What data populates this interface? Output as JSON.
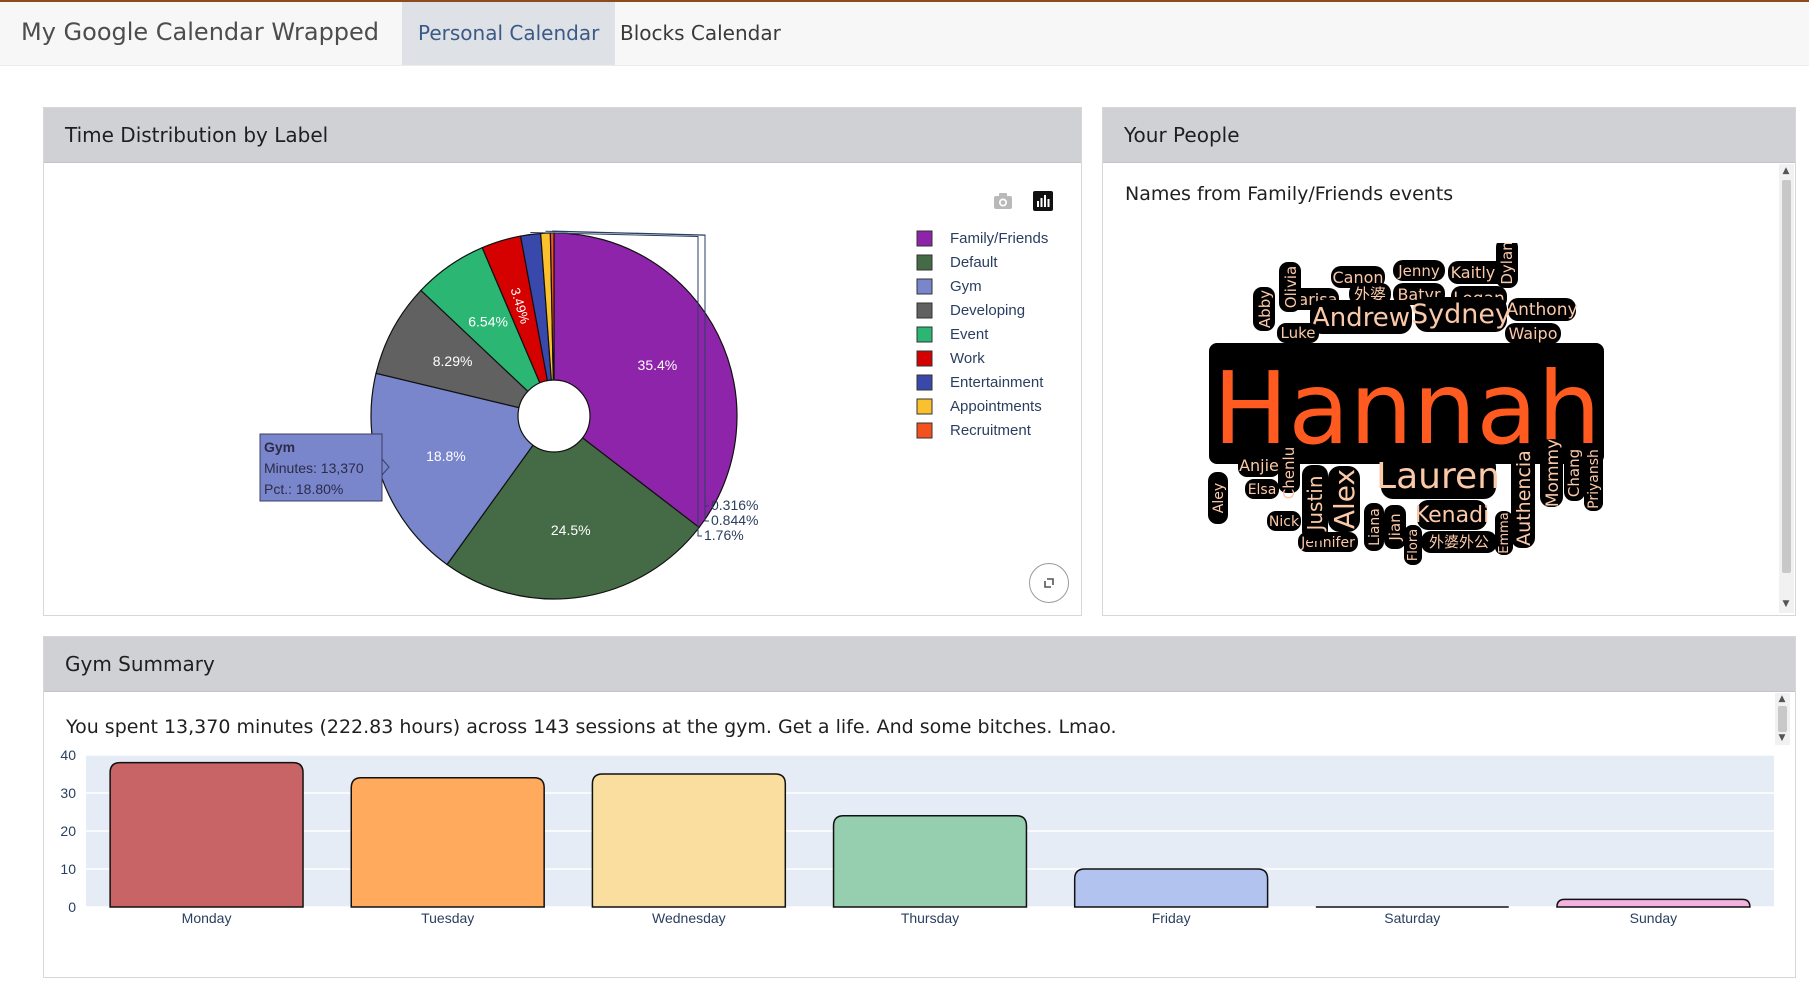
{
  "navbar": {
    "brand": "My Google Calendar Wrapped",
    "tabs": [
      {
        "label": "Personal Calendar",
        "active": true
      },
      {
        "label": "Blocks Calendar",
        "active": false
      }
    ]
  },
  "pie_card": {
    "title": "Time Distribution by Label",
    "tooltip": {
      "title": "Gym",
      "line1": "Minutes: 13,370",
      "line2": "Pct.: 18.80%"
    }
  },
  "people_card": {
    "title": "Your People",
    "subtitle": "Names from Family/Friends events",
    "words": [
      "Hannah",
      "Lauren",
      "Andrew",
      "Sydney",
      "Alex",
      "Kenadi",
      "Justin",
      "Authencia",
      "Anthony",
      "Logan",
      "Batyr",
      "Marisa",
      "Canon",
      "Jenny",
      "Kaitlyn",
      "Dylan",
      "Olivia",
      "Abby",
      "Luke",
      "Waipo",
      "外婆",
      "Anjie",
      "Elsa",
      "Aley",
      "Chenlu",
      "Nick",
      "Jennifer",
      "Liana",
      "Jian",
      "Flora",
      "外婆外公",
      "Emma",
      "Mommy",
      "Chang",
      "Priyansh"
    ]
  },
  "gym_card": {
    "title": "Gym Summary",
    "summary": "You spent 13,370 minutes (222.83 hours) across 143 sessions at the gym. Get a life. And some bitches. Lmao."
  },
  "chart_data": [
    {
      "type": "pie",
      "title": "",
      "hole": true,
      "legend_position": "right",
      "labels": [
        "Family/Friends",
        "Default",
        "Gym",
        "Developing",
        "Event",
        "Work",
        "Entertainment",
        "Appointments",
        "Recruitment"
      ],
      "values": [
        35.4,
        24.5,
        18.8,
        8.29,
        6.54,
        3.49,
        1.76,
        0.844,
        0.316
      ],
      "value_labels": [
        "35.4%",
        "24.5%",
        "18.8%",
        "8.29%",
        "6.54%",
        "3.49%",
        "1.76%",
        "0.844%",
        "0.316%"
      ],
      "colors": [
        "#8e24aa",
        "#446a46",
        "#7a86cc",
        "#616161",
        "#2bb673",
        "#d50000",
        "#3949ab",
        "#fbc02d",
        "#f4511e"
      ]
    },
    {
      "type": "bar",
      "title": "",
      "xlabel": "",
      "ylabel": "",
      "categories": [
        "Monday",
        "Tuesday",
        "Wednesday",
        "Thursday",
        "Friday",
        "Saturday",
        "Sunday"
      ],
      "values": [
        38,
        34,
        35,
        24,
        10,
        0,
        2
      ],
      "ylim": [
        0,
        40
      ],
      "yticks": [
        "0",
        "10",
        "20",
        "30",
        "40"
      ],
      "colors": [
        "#c96466",
        "#ffaa5c",
        "#f9dea0",
        "#96ceb0",
        "#b2c3ef",
        "#c8c8c8",
        "#f2b3e0"
      ],
      "grid": true
    }
  ]
}
